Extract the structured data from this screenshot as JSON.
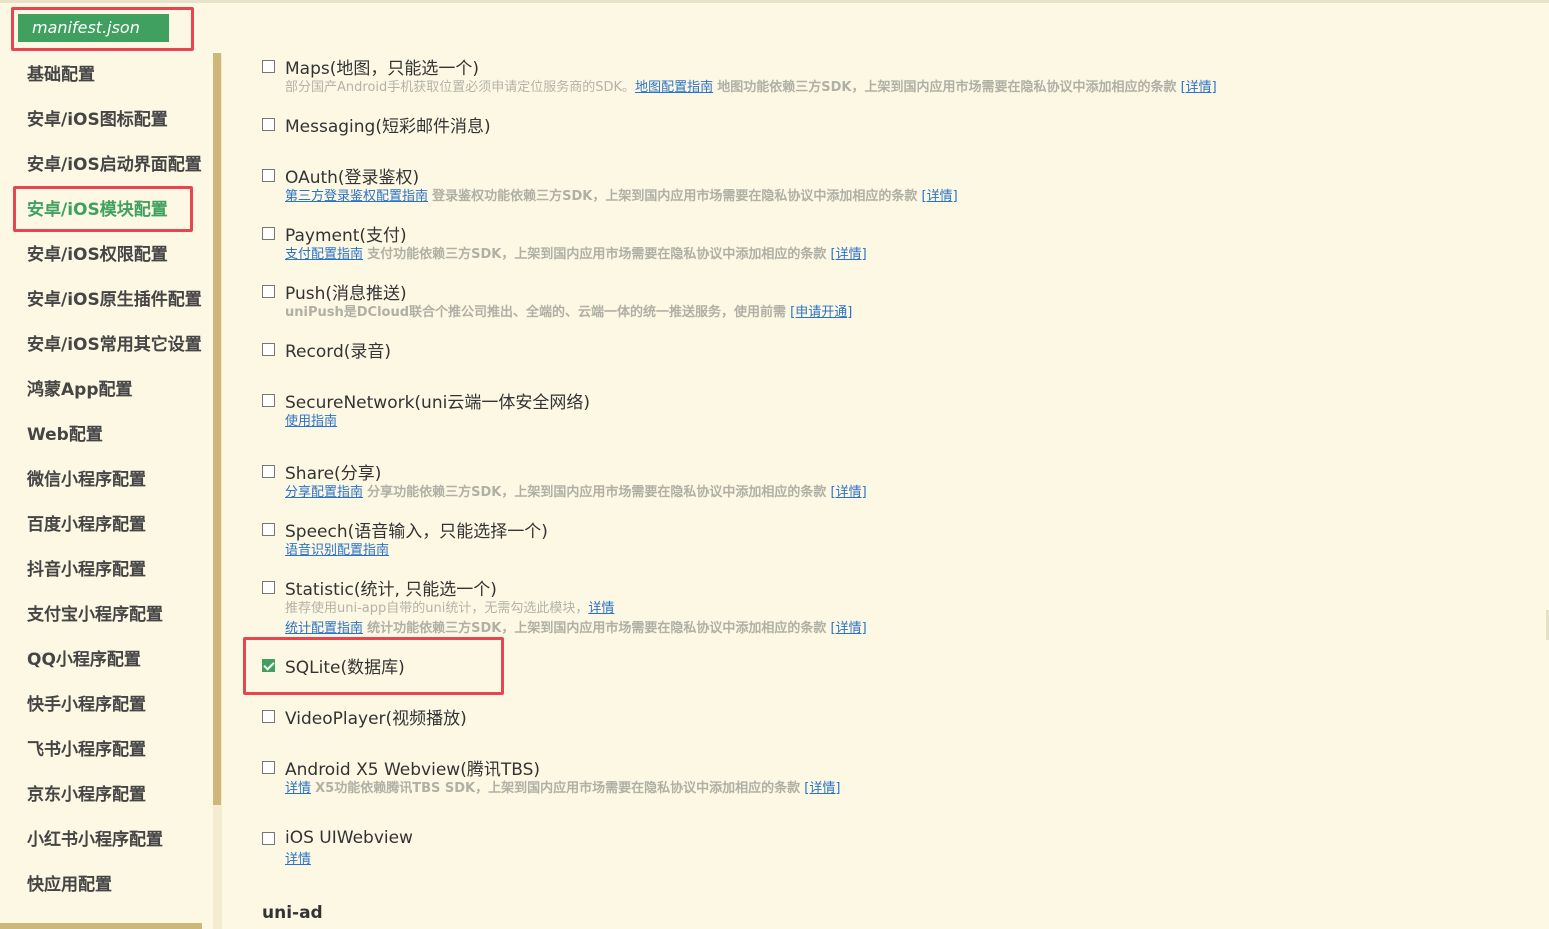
{
  "file_tab": {
    "label": "manifest.json"
  },
  "sidebar": {
    "items": [
      {
        "label": "基础配置"
      },
      {
        "label": "安卓/iOS图标配置"
      },
      {
        "label": "安卓/iOS启动界面配置"
      },
      {
        "label": "安卓/iOS模块配置",
        "active": true
      },
      {
        "label": "安卓/iOS权限配置"
      },
      {
        "label": "安卓/iOS原生插件配置"
      },
      {
        "label": "安卓/iOS常用其它设置"
      },
      {
        "label": "鸿蒙App配置"
      },
      {
        "label": "Web配置"
      },
      {
        "label": "微信小程序配置"
      },
      {
        "label": "百度小程序配置"
      },
      {
        "label": "抖音小程序配置"
      },
      {
        "label": "支付宝小程序配置"
      },
      {
        "label": "QQ小程序配置"
      },
      {
        "label": "快手小程序配置"
      },
      {
        "label": "飞书小程序配置"
      },
      {
        "label": "京东小程序配置"
      },
      {
        "label": "小红书小程序配置"
      },
      {
        "label": "快应用配置"
      }
    ]
  },
  "modules": {
    "maps": {
      "name": "Maps(地图，只能选一个)",
      "note": "部分国产Android手机获取位置必须申请定位服务商的SDK。",
      "guide": "地图配置指南",
      "compliance": "地图功能依赖三方SDK，上架到国内应用市场需要在隐私协议中添加相应的条款",
      "details": "[详情]"
    },
    "messaging": {
      "name": "Messaging(短彩邮件消息)"
    },
    "oauth": {
      "name": "OAuth(登录鉴权)",
      "guide": "第三方登录鉴权配置指南",
      "compliance": "登录鉴权功能依赖三方SDK，上架到国内应用市场需要在隐私协议中添加相应的条款",
      "details": "[详情]"
    },
    "payment": {
      "name": "Payment(支付)",
      "guide": "支付配置指南",
      "compliance": "支付功能依赖三方SDK，上架到国内应用市场需要在隐私协议中添加相应的条款",
      "details": "[详情]"
    },
    "push": {
      "name": "Push(消息推送)",
      "note": "uniPush是DCloud联合个推公司推出、全端的、云端一体的统一推送服务，使用前需",
      "apply": "[申请开通]"
    },
    "record": {
      "name": "Record(录音)"
    },
    "securenetwork": {
      "name": "SecureNetwork(uni云端一体安全网络)",
      "guide": "使用指南"
    },
    "share": {
      "name": "Share(分享)",
      "guide": "分享配置指南",
      "compliance": "分享功能依赖三方SDK，上架到国内应用市场需要在隐私协议中添加相应的条款",
      "details": "[详情]"
    },
    "speech": {
      "name": "Speech(语音输入，只能选择一个)",
      "guide": "语音识别配置指南"
    },
    "statistic": {
      "name": "Statistic(统计, 只能选一个)",
      "note": "推荐使用uni-app自带的uni统计，无需勾选此模块，",
      "note_link": "详情",
      "guide": "统计配置指南",
      "compliance": "统计功能依赖三方SDK，上架到国内应用市场需要在隐私协议中添加相应的条款",
      "details": "[详情]"
    },
    "sqlite": {
      "name": "SQLite(数据库)",
      "checked": true
    },
    "videoplayer": {
      "name": "VideoPlayer(视频播放)"
    },
    "x5": {
      "name": "Android X5 Webview(腾讯TBS)",
      "guide": "详情",
      "compliance": "X5功能依赖腾讯TBS SDK，上架到国内应用市场需要在隐私协议中添加相应的条款",
      "details": "[详情]"
    },
    "uiwebview": {
      "name": "iOS UIWebview",
      "guide": "详情"
    }
  },
  "section": {
    "title": "uni-ad"
  }
}
